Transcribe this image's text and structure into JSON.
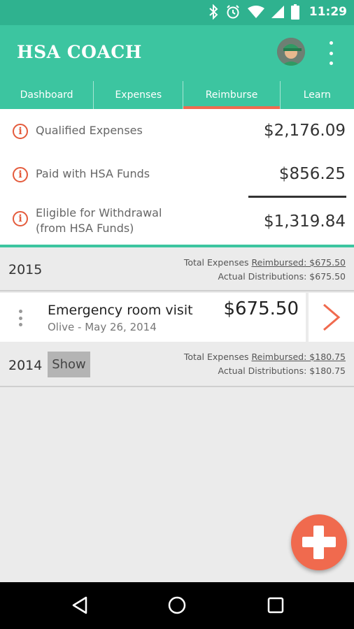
{
  "status_bar": {
    "time": "11:29"
  },
  "app": {
    "title": "HSA COACH"
  },
  "tabs": [
    {
      "label": "Dashboard"
    },
    {
      "label": "Expenses"
    },
    {
      "label": "Reimburse"
    },
    {
      "label": "Learn"
    }
  ],
  "active_tab": "Reimburse",
  "summary": {
    "qualified": {
      "label": "Qualified Expenses",
      "amount": "$2,176.09"
    },
    "paid": {
      "label": "Paid with HSA Funds",
      "amount": "$856.25"
    },
    "eligible": {
      "label_line1": "Eligible for Withdrawal",
      "label_line2": "(from HSA Funds)",
      "amount": "$1,319.84"
    }
  },
  "years": [
    {
      "year": "2015",
      "total_prefix": "Total Expenses ",
      "reimbursed_label": "Reimbursed: $675.50",
      "distributions": "Actual Distributions: $675.50"
    },
    {
      "year": "2014",
      "show_label": "Show",
      "total_prefix": "Total Expenses ",
      "reimbursed_label": "Reimbursed: $180.75",
      "distributions": "Actual Distributions: $180.75"
    }
  ],
  "expense": {
    "title": "Emergency room visit",
    "subtitle": "Olive - May 26, 2014",
    "amount": "$675.50"
  },
  "colors": {
    "accent": "#3cc5a0",
    "status": "#2fb28f",
    "highlight": "#f06a4e"
  },
  "icons": {
    "info": "info-icon",
    "chevron": "chevron-right-icon",
    "add": "plus-icon"
  }
}
